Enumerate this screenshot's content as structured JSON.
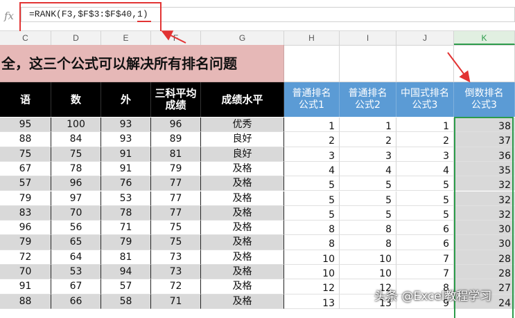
{
  "formula_bar": {
    "fx_label": "fx",
    "formula": "=RANK(F3,$F$3:$F$40,1)"
  },
  "column_headers": [
    "C",
    "D",
    "E",
    "F",
    "G",
    "H",
    "I",
    "J",
    "K"
  ],
  "selected_column": "K",
  "title": "全，这三个公式可以解决所有排名问题",
  "headers": {
    "c": "语",
    "d": "数",
    "e": "外",
    "f": "三科平均\n成绩",
    "g": "成绩水平",
    "h": "普通排名\n公式1",
    "i": "普通排名\n公式2",
    "j": "中国式排名\n公式3",
    "k": "倒数排名\n公式3"
  },
  "rows": [
    {
      "c": "95",
      "d": "100",
      "e": "93",
      "f": "96",
      "g": "优秀",
      "h": "1",
      "i": "1",
      "j": "1",
      "k": "38"
    },
    {
      "c": "88",
      "d": "84",
      "e": "93",
      "f": "89",
      "g": "良好",
      "h": "2",
      "i": "2",
      "j": "2",
      "k": "37"
    },
    {
      "c": "75",
      "d": "75",
      "e": "91",
      "f": "81",
      "g": "良好",
      "h": "3",
      "i": "3",
      "j": "3",
      "k": "36"
    },
    {
      "c": "67",
      "d": "78",
      "e": "91",
      "f": "79",
      "g": "及格",
      "h": "4",
      "i": "4",
      "j": "4",
      "k": "35"
    },
    {
      "c": "57",
      "d": "96",
      "e": "76",
      "f": "77",
      "g": "及格",
      "h": "5",
      "i": "5",
      "j": "5",
      "k": "32"
    },
    {
      "c": "79",
      "d": "97",
      "e": "53",
      "f": "77",
      "g": "及格",
      "h": "5",
      "i": "5",
      "j": "5",
      "k": "32"
    },
    {
      "c": "83",
      "d": "70",
      "e": "78",
      "f": "77",
      "g": "及格",
      "h": "5",
      "i": "5",
      "j": "5",
      "k": "32"
    },
    {
      "c": "96",
      "d": "56",
      "e": "71",
      "f": "75",
      "g": "及格",
      "h": "8",
      "i": "8",
      "j": "6",
      "k": "30"
    },
    {
      "c": "79",
      "d": "65",
      "e": "79",
      "f": "75",
      "g": "及格",
      "h": "8",
      "i": "8",
      "j": "6",
      "k": "30"
    },
    {
      "c": "72",
      "d": "64",
      "e": "81",
      "f": "73",
      "g": "及格",
      "h": "10",
      "i": "10",
      "j": "7",
      "k": "28"
    },
    {
      "c": "70",
      "d": "53",
      "e": "94",
      "f": "73",
      "g": "及格",
      "h": "10",
      "i": "10",
      "j": "7",
      "k": "28"
    },
    {
      "c": "91",
      "d": "67",
      "e": "57",
      "f": "72",
      "g": "及格",
      "h": "12",
      "i": "12",
      "j": "8",
      "k": "27"
    },
    {
      "c": "88",
      "d": "66",
      "e": "58",
      "f": "71",
      "g": "及格",
      "h": "13",
      "i": "13",
      "j": "9",
      "k": "24"
    }
  ],
  "watermark": "头条 @Excel教程学习",
  "colors": {
    "title_bg": "#e6b8b7",
    "header_black": "#000000",
    "header_blue": "#5b9bd5",
    "row_stripe": "#d9d9d9",
    "selection_green": "#2c9b4a",
    "annotation_red": "#e23333"
  }
}
